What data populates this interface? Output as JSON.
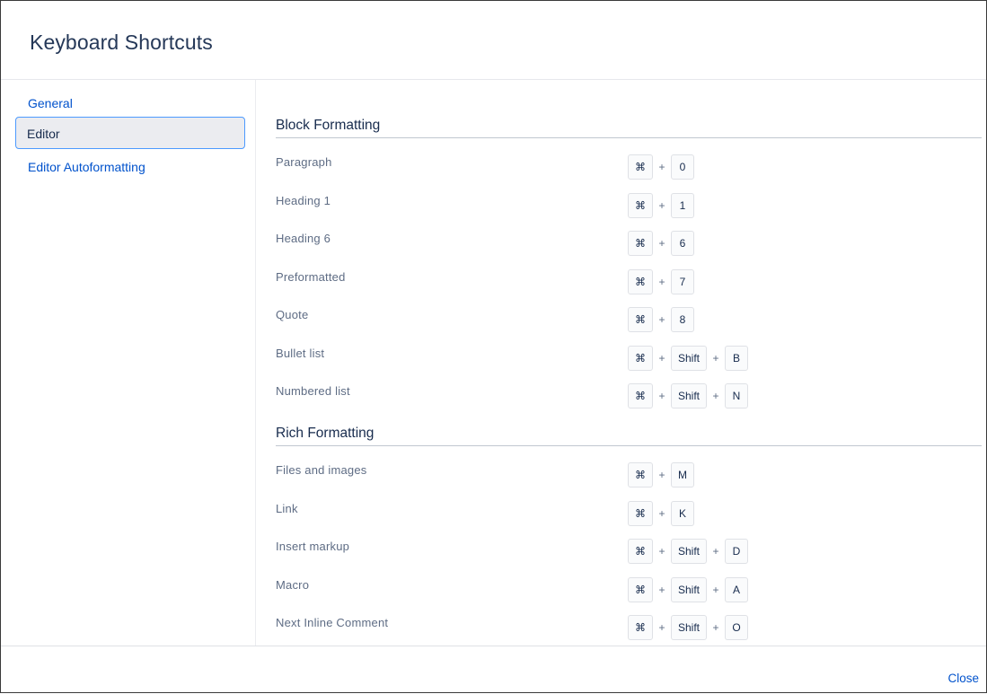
{
  "dialog": {
    "title": "Keyboard Shortcuts",
    "close_label": "Close"
  },
  "sidebar": {
    "items": [
      {
        "label": "General",
        "active": false
      },
      {
        "label": "Editor",
        "active": true
      },
      {
        "label": "Editor Autoformatting",
        "active": false
      }
    ]
  },
  "sections": [
    {
      "title": "Block Formatting",
      "rows": [
        {
          "label": "Paragraph",
          "keys": [
            "⌘",
            "0"
          ]
        },
        {
          "label": "Heading 1",
          "keys": [
            "⌘",
            "1"
          ]
        },
        {
          "label": "Heading 6",
          "keys": [
            "⌘",
            "6"
          ]
        },
        {
          "label": "Preformatted",
          "keys": [
            "⌘",
            "7"
          ]
        },
        {
          "label": "Quote",
          "keys": [
            "⌘",
            "8"
          ]
        },
        {
          "label": "Bullet list",
          "keys": [
            "⌘",
            "Shift",
            "B"
          ]
        },
        {
          "label": "Numbered list",
          "keys": [
            "⌘",
            "Shift",
            "N"
          ]
        }
      ]
    },
    {
      "title": "Rich Formatting",
      "rows": [
        {
          "label": "Files and images",
          "keys": [
            "⌘",
            "M"
          ]
        },
        {
          "label": "Link",
          "keys": [
            "⌘",
            "K"
          ]
        },
        {
          "label": "Insert markup",
          "keys": [
            "⌘",
            "Shift",
            "D"
          ]
        },
        {
          "label": "Macro",
          "keys": [
            "⌘",
            "Shift",
            "A"
          ]
        },
        {
          "label": "Next Inline Comment",
          "keys": [
            "⌘",
            "Shift",
            "O"
          ]
        }
      ]
    }
  ],
  "separator": "+"
}
